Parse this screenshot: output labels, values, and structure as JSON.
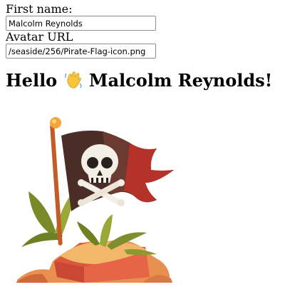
{
  "form": {
    "first_name_label": "First name:",
    "first_name_value": "Malcolm Reynolds",
    "avatar_url_label": "Avatar URL",
    "avatar_url_value": "/seaside/256/Pirate-Flag-icon.png"
  },
  "greeting": {
    "prefix": "Hello",
    "emoji_icon": "waving-hand-icon",
    "name": "Malcolm Reynolds",
    "suffix": "!"
  },
  "avatar": {
    "icon": "pirate-flag-icon"
  }
}
